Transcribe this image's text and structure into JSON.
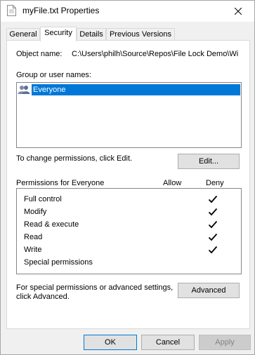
{
  "window": {
    "title": "myFile.txt Properties"
  },
  "tabs": [
    {
      "label": "General"
    },
    {
      "label": "Security"
    },
    {
      "label": "Details"
    },
    {
      "label": "Previous Versions"
    }
  ],
  "security": {
    "object_name_label": "Object name:",
    "object_name_value": "C:\\Users\\philh\\Source\\Repos\\File Lock Demo\\Wi",
    "group_label": "Group or user names:",
    "groups": [
      {
        "label": "Everyone",
        "selected": true
      }
    ],
    "change_text": "To change permissions, click Edit.",
    "edit_button": "Edit...",
    "permissions_for": "Permissions for Everyone",
    "allow_header": "Allow",
    "deny_header": "Deny",
    "permissions": [
      {
        "name": "Full control",
        "allow": false,
        "deny": true
      },
      {
        "name": "Modify",
        "allow": false,
        "deny": true
      },
      {
        "name": "Read & execute",
        "allow": false,
        "deny": true
      },
      {
        "name": "Read",
        "allow": false,
        "deny": true
      },
      {
        "name": "Write",
        "allow": false,
        "deny": true
      },
      {
        "name": "Special permissions",
        "allow": false,
        "deny": false
      }
    ],
    "advanced_text_1": "For special permissions or advanced settings,",
    "advanced_text_2": "click Advanced.",
    "advanced_button": "Advanced"
  },
  "footer": {
    "ok": "OK",
    "cancel": "Cancel",
    "apply": "Apply"
  },
  "icons": [
    "document-icon",
    "close-icon",
    "users-icon",
    "checkmark-icon"
  ],
  "colors": {
    "selection": "#0078d7",
    "window_bg": "#f0f0f0",
    "panel_bg": "#ffffff"
  }
}
